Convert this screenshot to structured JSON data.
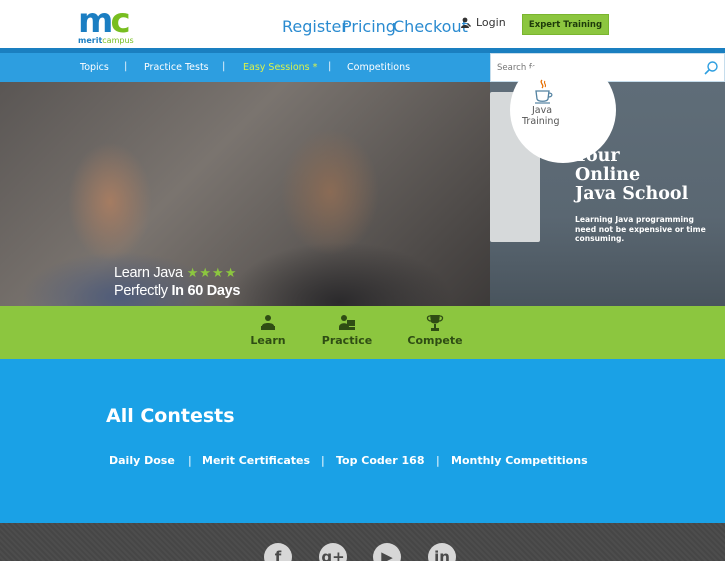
{
  "header": {
    "logo_mc_m": "m",
    "logo_mc_c": "c",
    "logo_text_a": "merit",
    "logo_text_b": "campus",
    "links": [
      "Register",
      "Pricing",
      "Checkout"
    ],
    "login": "Login",
    "expert_button": "Expert Training"
  },
  "nav": {
    "items": [
      "Topics",
      "Practice Tests",
      "Easy Sessions *",
      "Competitions"
    ],
    "separator": "|",
    "active": "Easy Sessions *",
    "search_placeholder": "Search for Topics"
  },
  "hero": {
    "java_label_1": "Java",
    "java_label_2": "Training",
    "headline_1": "Your",
    "headline_2": "Online",
    "headline_3": "Java School",
    "sub": "Learning Java programming need not be expensive or time consuming.",
    "learn_line_1": "Learn Java",
    "learn_line_2a": "Perfectly",
    "learn_line_2b": "In 60 Days",
    "stars": "★★★★"
  },
  "tabs": [
    "Learn",
    "Practice",
    "Compete"
  ],
  "contests": {
    "title": "All Contests",
    "links": [
      "Daily Dose",
      "Merit Certificates",
      "Top Coder 168",
      "Monthly Competitions"
    ],
    "separator": "|"
  },
  "footer": {
    "social": [
      {
        "name": "facebook-icon",
        "glyph": "f"
      },
      {
        "name": "google-plus-icon",
        "glyph": "g+"
      },
      {
        "name": "youtube-icon",
        "glyph": "▶"
      },
      {
        "name": "linkedin-icon",
        "glyph": "in"
      }
    ]
  },
  "colors": {
    "brand_blue": "#1a7fc0",
    "nav_blue": "#2d9ee0",
    "contests_blue": "#1aa1e6",
    "green": "#8cc63f",
    "active_nav": "#d9f24a"
  }
}
